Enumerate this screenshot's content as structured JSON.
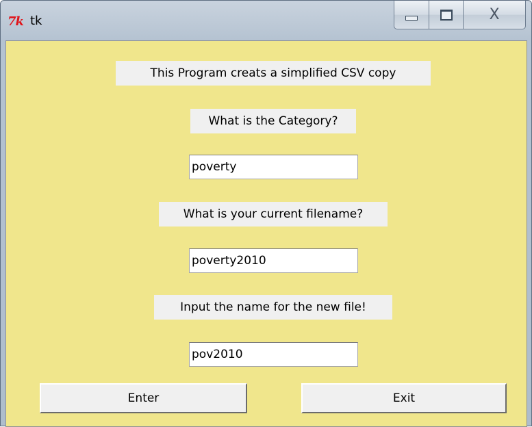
{
  "window": {
    "title": "tk",
    "app_icon": "tk-logo-icon",
    "caption_buttons": {
      "minimize_icon": "minimize-icon",
      "maximize_icon": "maximize-icon",
      "close_icon": "close-icon",
      "close_glyph": "X"
    }
  },
  "colors": {
    "client_background": "#f0e68c",
    "label_background": "#f0f0f0"
  },
  "form": {
    "intro_label": "This Program creats a simplified CSV copy",
    "category_label": "What is the Category?",
    "category_value": "poverty",
    "filename_label": "What is your current filename?",
    "filename_value": "poverty2010",
    "newfile_label": "Input the name for the new file!",
    "newfile_value": "pov2010"
  },
  "buttons": {
    "enter_label": "Enter",
    "exit_label": "Exit"
  }
}
